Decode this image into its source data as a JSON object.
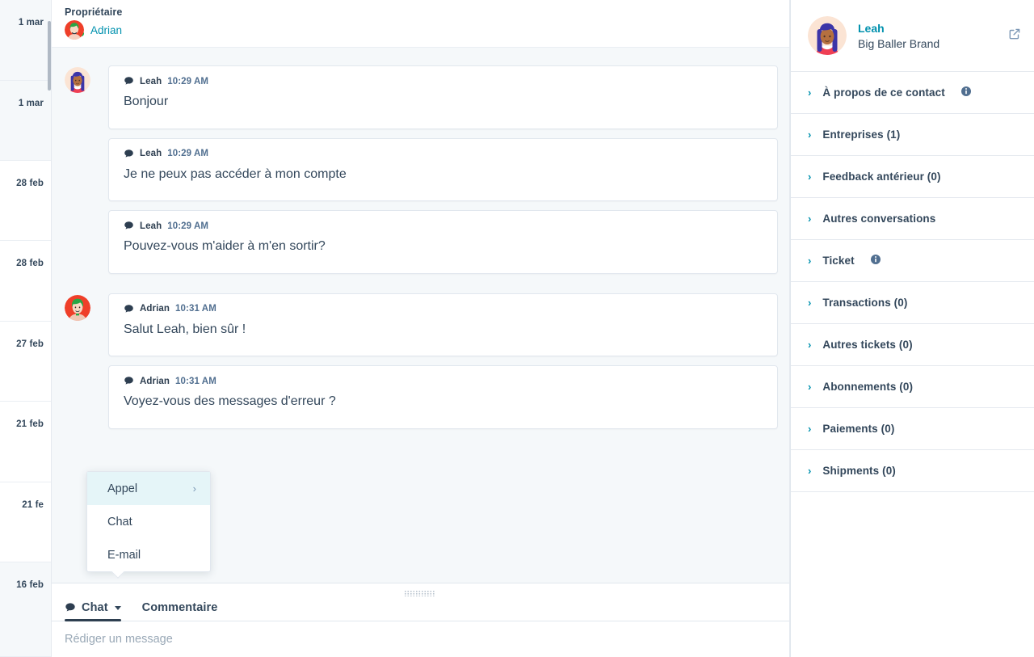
{
  "date_rail": {
    "items": [
      {
        "label": "1 mar",
        "shaded": true,
        "height": 100
      },
      {
        "label": "1 mar",
        "shaded": true,
        "height": 99
      },
      {
        "label": "28 feb",
        "shaded": false,
        "height": 99
      },
      {
        "label": "28 feb",
        "shaded": false,
        "height": 100
      },
      {
        "label": "27 feb",
        "shaded": false,
        "height": 99
      },
      {
        "label": "21 feb",
        "shaded": false,
        "height": 100
      },
      {
        "label": "21 fe",
        "shaded": false,
        "height": 99
      },
      {
        "label": "16 feb",
        "shaded": true,
        "height": 117
      }
    ]
  },
  "conversation": {
    "owner_label": "Propriétaire",
    "owner_name": "Adrian",
    "groups": [
      {
        "avatar": "leah",
        "messages": [
          {
            "icon": "chat-icon",
            "sender": "Leah",
            "time": "10:29 AM",
            "text": "Bonjour"
          },
          {
            "icon": "chat-icon",
            "sender": "Leah",
            "time": "10:29 AM",
            "text": "Je ne peux pas accéder à mon compte"
          },
          {
            "icon": "chat-icon",
            "sender": "Leah",
            "time": "10:29 AM",
            "text": "Pouvez-vous m'aider à m'en sortir?"
          }
        ]
      },
      {
        "avatar": "adrian",
        "messages": [
          {
            "icon": "chat-icon",
            "sender": "Adrian",
            "time": "10:31 AM",
            "text": "Salut Leah, bien sûr !"
          },
          {
            "icon": "chat-icon",
            "sender": "Adrian",
            "time": "10:31 AM",
            "text": "Voyez-vous des messages d'erreur ?"
          }
        ]
      }
    ]
  },
  "popup_menu": {
    "items": [
      {
        "label": "Appel",
        "has_submenu": true,
        "submenu_glyph": "›",
        "highlighted": true
      },
      {
        "label": "Chat",
        "has_submenu": false,
        "submenu_glyph": "",
        "highlighted": false
      },
      {
        "label": "E-mail",
        "has_submenu": false,
        "submenu_glyph": "",
        "highlighted": false
      }
    ]
  },
  "composer": {
    "tabs": [
      {
        "label": "Chat",
        "icon": "chat-icon",
        "caret": true,
        "active": true
      },
      {
        "label": "Commentaire",
        "icon": "",
        "caret": false,
        "active": false
      }
    ],
    "placeholder": "Rédiger un message"
  },
  "sidebar": {
    "contact": {
      "name": "Leah",
      "company": "Big Baller Brand",
      "open_record_icon": "external-link-icon"
    },
    "panels": [
      {
        "label": "À propos de ce contact",
        "info": true
      },
      {
        "label": "Entreprises (1)",
        "info": false
      },
      {
        "label": "Feedback antérieur (0)",
        "info": false
      },
      {
        "label": "Autres conversations",
        "info": false
      },
      {
        "label": "Ticket",
        "info": true
      },
      {
        "label": "Transactions (0)",
        "info": false
      },
      {
        "label": "Autres tickets (0)",
        "info": false
      },
      {
        "label": "Abonnements (0)",
        "info": false
      },
      {
        "label": "Paiements (0)",
        "info": false
      },
      {
        "label": "Shipments (0)",
        "info": false
      }
    ]
  },
  "colors": {
    "accent_teal": "#0091ae",
    "text_dark": "#33475b",
    "canvas": "#f5f8fa",
    "border": "#e1e7ee",
    "highlight": "#e5f5f8",
    "online": "#00bd47"
  }
}
